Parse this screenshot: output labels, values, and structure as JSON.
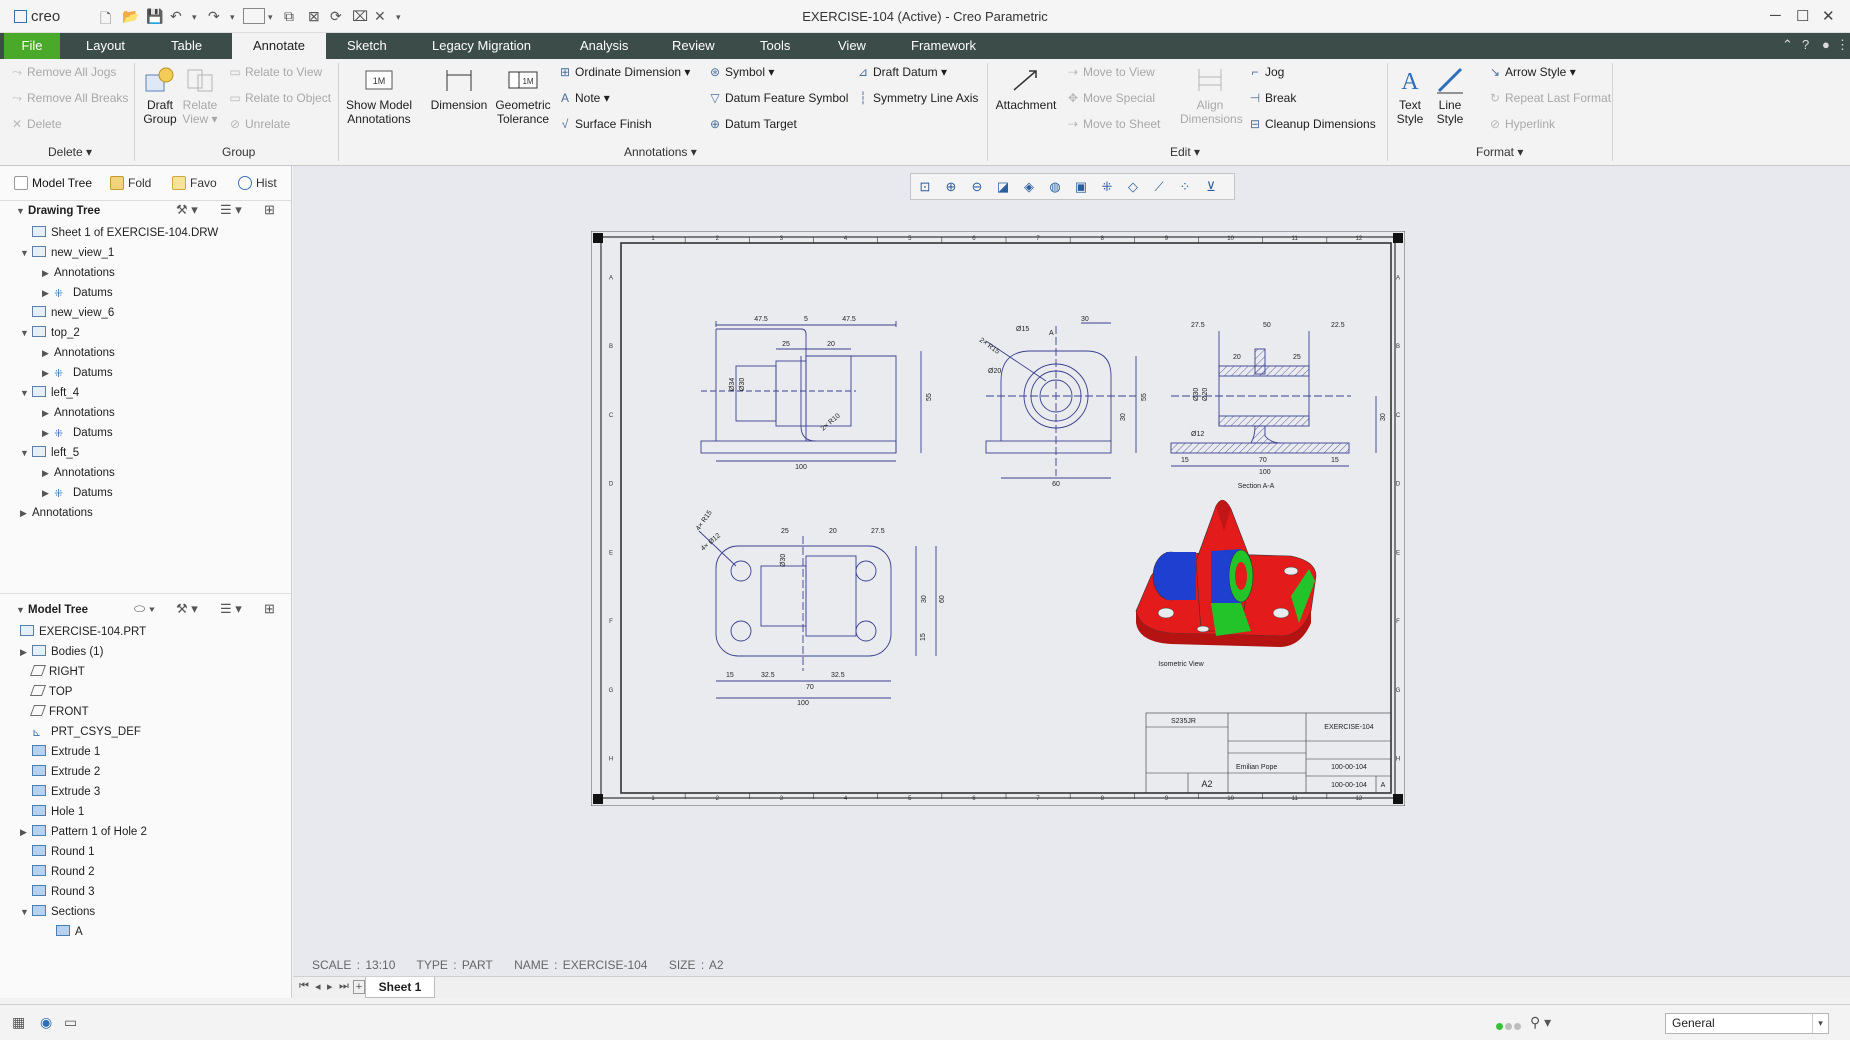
{
  "app": {
    "logo": "creo",
    "window_title": "EXERCISE-104 (Active) - Creo Parametric"
  },
  "ribbon_tabs": [
    "File",
    "Layout",
    "Table",
    "Annotate",
    "Sketch",
    "Legacy Migration",
    "Analysis",
    "Review",
    "Tools",
    "View",
    "Framework"
  ],
  "active_tab": "Annotate",
  "ribbon": {
    "delete_group": {
      "remove_all_jogs": "Remove All Jogs",
      "remove_all_breaks": "Remove All Breaks",
      "delete": "Delete",
      "label": "Delete"
    },
    "group_group": {
      "draft_group": "Draft Group",
      "relate_view": "Relate View",
      "relate_to_view": "Relate to View",
      "relate_to_object": "Relate to Object",
      "unrelate": "Unrelate",
      "label": "Group"
    },
    "annotations_group": {
      "show_model_annotations": "Show Model Annotations",
      "dimension": "Dimension",
      "geometric_tolerance": "Geometric Tolerance",
      "ordinate_dimension": "Ordinate Dimension",
      "note": "Note",
      "surface_finish": "Surface Finish",
      "symbol": "Symbol",
      "datum_feature_symbol": "Datum Feature Symbol",
      "datum_target": "Datum Target",
      "draft_datum": "Draft Datum",
      "symmetry_line_axis": "Symmetry Line Axis",
      "label": "Annotations"
    },
    "edit_group": {
      "attachment": "Attachment",
      "move_to_view": "Move to View",
      "move_special": "Move Special",
      "move_to_sheet": "Move to Sheet",
      "align_dimensions": "Align Dimensions",
      "jog": "Jog",
      "break": "Break",
      "cleanup_dimensions": "Cleanup Dimensions",
      "label": "Edit"
    },
    "format_group": {
      "text_style": "Text Style",
      "line_style": "Line Style",
      "arrow_style": "Arrow Style",
      "repeat_last_format": "Repeat Last Format",
      "hyperlink": "Hyperlink",
      "label": "Format"
    }
  },
  "panel_tabs": [
    "Model Tree",
    "Fold",
    "Favo",
    "Hist"
  ],
  "drawing_tree": {
    "title": "Drawing Tree",
    "items": [
      {
        "label": "Sheet 1 of EXERCISE-104.DRW",
        "level": 0,
        "twisty": "",
        "icon": "sheet"
      },
      {
        "label": "new_view_1",
        "level": 0,
        "twisty": "open",
        "icon": "view"
      },
      {
        "label": "Annotations",
        "level": 1,
        "twisty": "closed",
        "icon": ""
      },
      {
        "label": "Datums",
        "level": 1,
        "twisty": "closed",
        "icon": "datum"
      },
      {
        "label": "new_view_6",
        "level": 0,
        "twisty": "",
        "icon": "view"
      },
      {
        "label": "top_2",
        "level": 0,
        "twisty": "open",
        "icon": "view2"
      },
      {
        "label": "Annotations",
        "level": 1,
        "twisty": "closed",
        "icon": ""
      },
      {
        "label": "Datums",
        "level": 1,
        "twisty": "closed",
        "icon": "datum"
      },
      {
        "label": "left_4",
        "level": 0,
        "twisty": "open",
        "icon": "view2"
      },
      {
        "label": "Annotations",
        "level": 1,
        "twisty": "closed",
        "icon": ""
      },
      {
        "label": "Datums",
        "level": 1,
        "twisty": "closed",
        "icon": "datum"
      },
      {
        "label": "left_5",
        "level": 0,
        "twisty": "open",
        "icon": "view2"
      },
      {
        "label": "Annotations",
        "level": 1,
        "twisty": "closed",
        "icon": ""
      },
      {
        "label": "Datums",
        "level": 1,
        "twisty": "closed",
        "icon": "datum"
      },
      {
        "label": "Annotations",
        "level": -1,
        "twisty": "closed",
        "icon": ""
      }
    ]
  },
  "model_tree": {
    "title": "Model Tree",
    "items": [
      {
        "label": "EXERCISE-104.PRT",
        "twisty": "",
        "icon": "part"
      },
      {
        "label": "Bodies (1)",
        "twisty": "closed",
        "icon": "body"
      },
      {
        "label": "RIGHT",
        "twisty": "",
        "icon": "plane"
      },
      {
        "label": "TOP",
        "twisty": "",
        "icon": "plane"
      },
      {
        "label": "FRONT",
        "twisty": "",
        "icon": "plane"
      },
      {
        "label": "PRT_CSYS_DEF",
        "twisty": "",
        "icon": "csys"
      },
      {
        "label": "Extrude 1",
        "twisty": "",
        "icon": "feat"
      },
      {
        "label": "Extrude 2",
        "twisty": "",
        "icon": "feat"
      },
      {
        "label": "Extrude 3",
        "twisty": "",
        "icon": "feat"
      },
      {
        "label": "Hole 1",
        "twisty": "",
        "icon": "feat"
      },
      {
        "label": "Pattern 1 of Hole 2",
        "twisty": "closed",
        "icon": "pattern"
      },
      {
        "label": "Round 1",
        "twisty": "",
        "icon": "feat"
      },
      {
        "label": "Round 2",
        "twisty": "",
        "icon": "feat"
      },
      {
        "label": "Round 3",
        "twisty": "",
        "icon": "feat"
      },
      {
        "label": "Sections",
        "twisty": "open",
        "icon": "feat"
      },
      {
        "label": "A",
        "twisty": "",
        "icon": "section"
      }
    ]
  },
  "drawing": {
    "section_label": "Section A-A",
    "iso_label": "Isometric View",
    "material": "S235JR",
    "title_exercise": "EXERCISE-104",
    "part_no": "100-00-104",
    "size": "A2",
    "author": "Emilian Pope",
    "revision": "A",
    "dims_front": [
      "47.5",
      "5",
      "47.5",
      "25",
      "20",
      "Ø34",
      "Ø30",
      "55",
      "2× R10",
      "100"
    ],
    "dims_side": [
      "30",
      "2× R15",
      "Ø15",
      "Ø20",
      "A",
      "55",
      "30",
      "60"
    ],
    "dims_section": [
      "27.5",
      "50",
      "22.5",
      "20",
      "25",
      "Ø30",
      "Ø20",
      "Ø12",
      "30",
      "15",
      "70",
      "15",
      "100"
    ],
    "dims_top": [
      "4× R15",
      "4× Ø12",
      "25",
      "20",
      "27.5",
      "Ø30",
      "30",
      "60",
      "15",
      "15",
      "32.5",
      "32.5",
      "70",
      "100"
    ],
    "border_cols": [
      "1",
      "2",
      "3",
      "4",
      "5",
      "6",
      "7",
      "8",
      "9",
      "10",
      "11",
      "12"
    ],
    "border_rows": [
      "A",
      "B",
      "C",
      "D",
      "E",
      "F",
      "G",
      "H"
    ]
  },
  "status_info": {
    "scale": "SCALE : 13:10",
    "type": "TYPE : PART",
    "name": "NAME : EXERCISE-104",
    "size": "SIZE : A2"
  },
  "sheet_tabs": [
    "Sheet 1"
  ],
  "filter_value": "General",
  "colors": {
    "tab_bar": "#3c4c48",
    "file_tab": "#4aa928",
    "graphics_bg": "#e7e9ee",
    "line_blue": "#3a3f8f",
    "iso_red": "#e41b1b",
    "iso_blue": "#1f3fd0",
    "iso_green": "#22c42a"
  }
}
